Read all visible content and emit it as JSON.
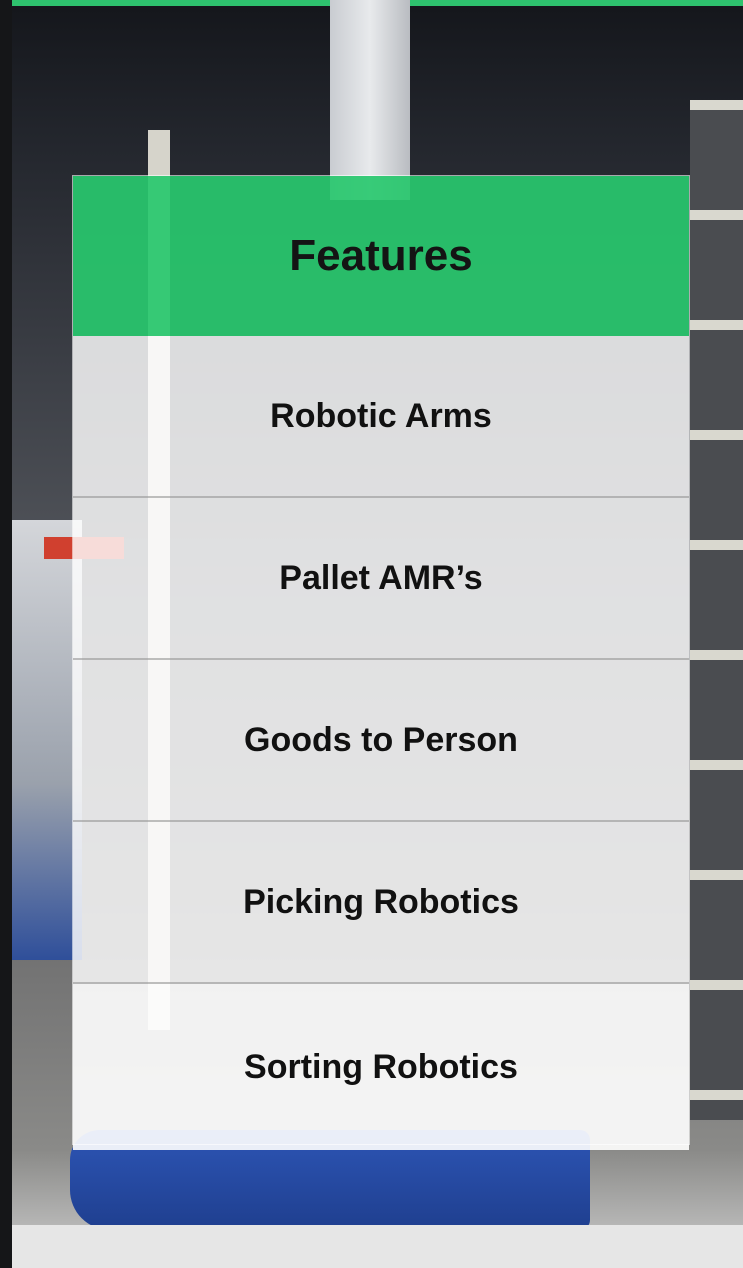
{
  "card": {
    "title": "Features",
    "header_color": "#2ec26e",
    "items": [
      {
        "label": "Robotic Arms"
      },
      {
        "label": "Pallet AMR’s"
      },
      {
        "label": "Goods to Person"
      },
      {
        "label": "Picking Robotics"
      },
      {
        "label": "Sorting Robotics"
      }
    ]
  }
}
